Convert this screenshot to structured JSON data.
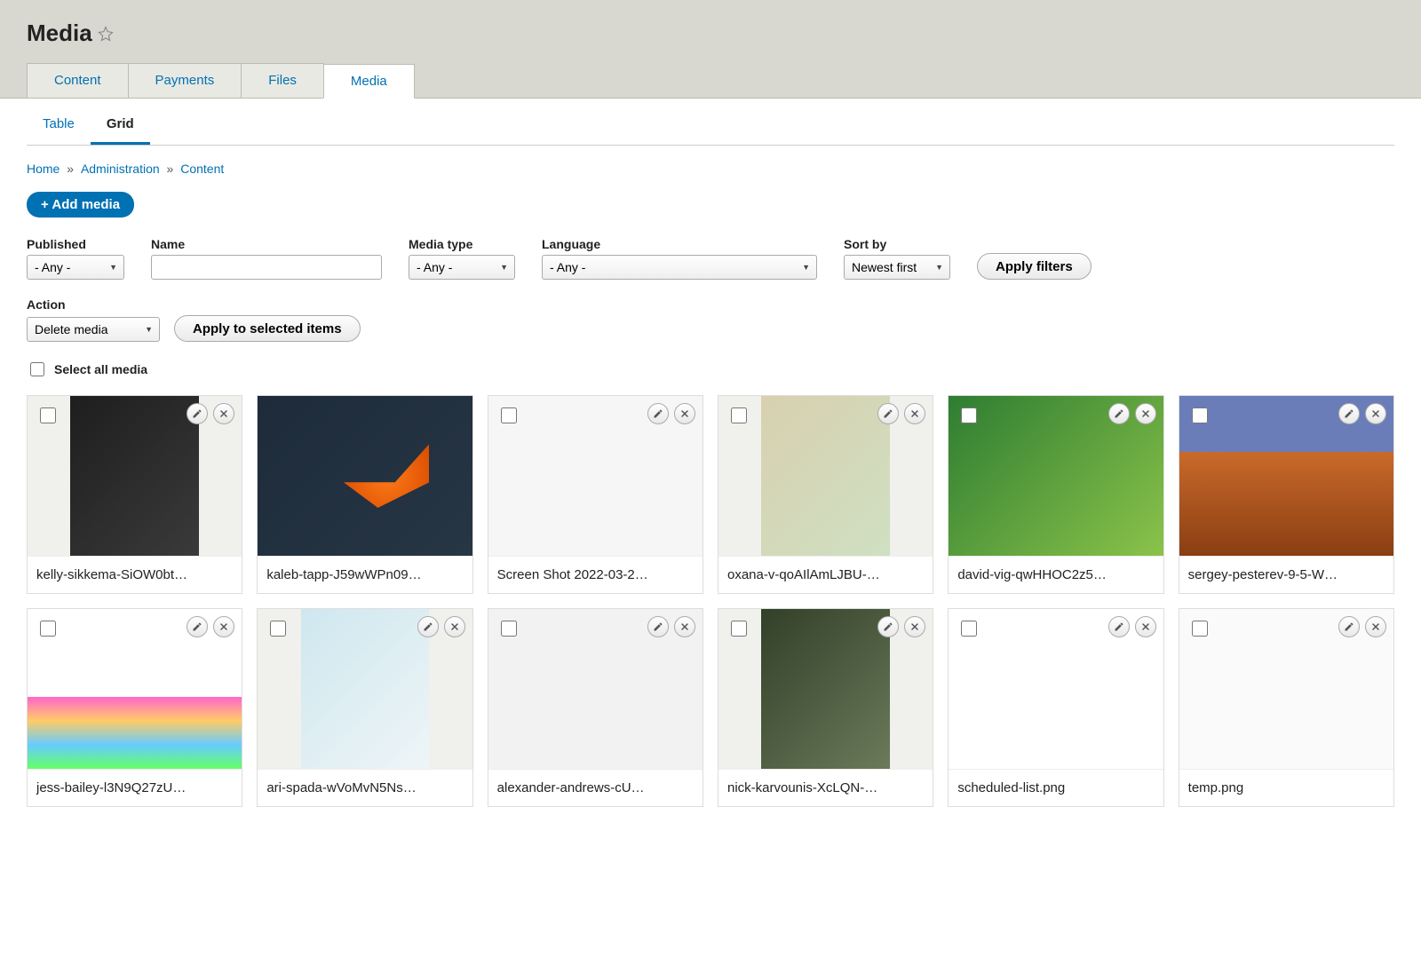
{
  "page": {
    "title": "Media"
  },
  "primary_tabs": [
    {
      "label": "Content",
      "active": false
    },
    {
      "label": "Payments",
      "active": false
    },
    {
      "label": "Files",
      "active": false
    },
    {
      "label": "Media",
      "active": true
    }
  ],
  "secondary_tabs": [
    {
      "label": "Table",
      "active": false
    },
    {
      "label": "Grid",
      "active": true
    }
  ],
  "breadcrumb": {
    "items": [
      "Home",
      "Administration",
      "Content"
    ],
    "sep": "»"
  },
  "buttons": {
    "add_media": "+ Add media",
    "apply_filters": "Apply filters",
    "apply_selected": "Apply to selected items"
  },
  "filters": {
    "published": {
      "label": "Published",
      "value": "- Any -"
    },
    "name": {
      "label": "Name",
      "value": ""
    },
    "media_type": {
      "label": "Media type",
      "value": "- Any -"
    },
    "language": {
      "label": "Language",
      "value": "- Any -"
    },
    "sort_by": {
      "label": "Sort by",
      "value": "Newest first"
    }
  },
  "action": {
    "label": "Action",
    "value": "Delete media"
  },
  "select_all": {
    "label": "Select all media",
    "checked": false
  },
  "media_items": [
    {
      "title": "kelly-sikkema-SiOW0bt…",
      "swatch": "sw-dark",
      "thumb": "tall"
    },
    {
      "title": "kaleb-tapp-J59wWPn09…",
      "swatch": "sw-brick",
      "thumb": "full"
    },
    {
      "title": "Screen Shot 2022-03-2…",
      "swatch": "sw-form",
      "thumb": "full"
    },
    {
      "title": "oxana-v-qoAIlAmLJBU-…",
      "swatch": "sw-map",
      "thumb": "tall"
    },
    {
      "title": "david-vig-qwHHOC2z5…",
      "swatch": "sw-tree",
      "thumb": "full"
    },
    {
      "title": "sergey-pesterev-9-5-W…",
      "swatch": "sw-desert",
      "thumb": "full"
    },
    {
      "title": "jess-bailey-l3N9Q27zU…",
      "swatch": "sw-pencils",
      "thumb": "full"
    },
    {
      "title": "ari-spada-wVoMvN5Ns…",
      "swatch": "sw-arch",
      "thumb": "tall"
    },
    {
      "title": "alexander-andrews-cU…",
      "swatch": "sw-camera",
      "thumb": "full"
    },
    {
      "title": "nick-karvounis-XcLQN-…",
      "swatch": "sw-hands",
      "thumb": "tall"
    },
    {
      "title": "scheduled-list.png",
      "swatch": "sw-list",
      "thumb": "full"
    },
    {
      "title": "temp.png",
      "swatch": "sw-temp",
      "thumb": "full"
    }
  ]
}
